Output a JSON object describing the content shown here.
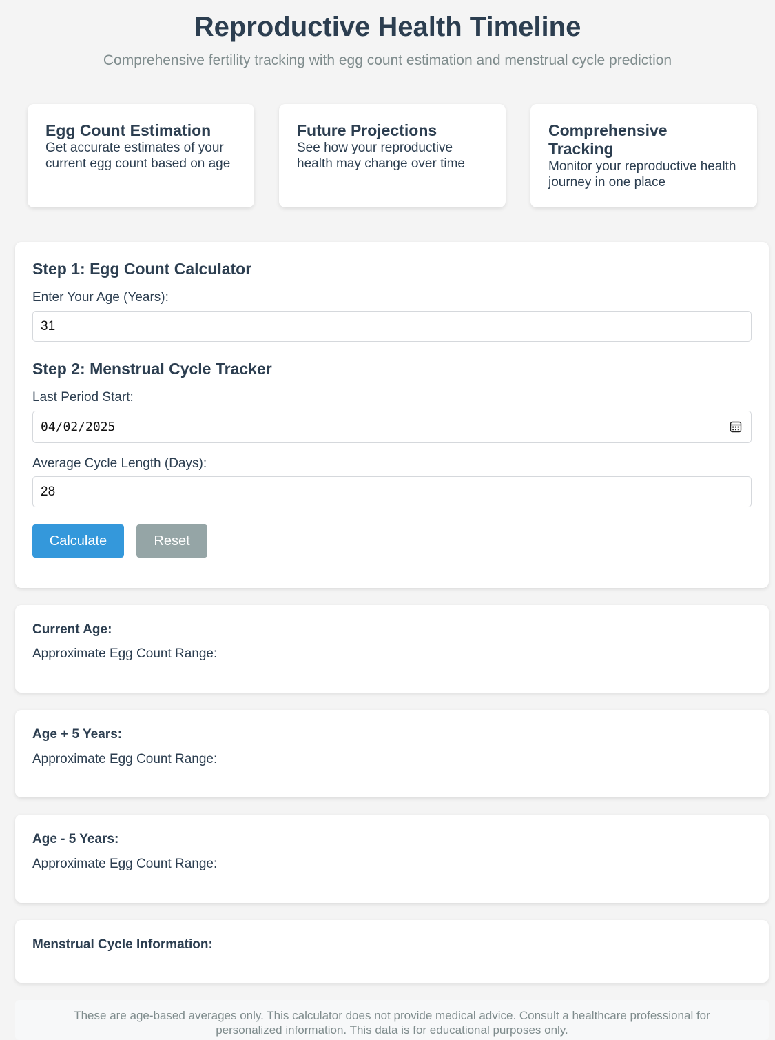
{
  "header": {
    "title": "Reproductive Health Timeline",
    "subtitle": "Comprehensive fertility tracking with egg count estimation and menstrual cycle prediction"
  },
  "features": [
    {
      "title": "Egg Count Estimation",
      "description": "Get accurate estimates of your current egg count based on age"
    },
    {
      "title": "Future Projections",
      "description": "See how your reproductive health may change over time"
    },
    {
      "title": "Comprehensive Tracking",
      "description": "Monitor your reproductive health journey in one place"
    }
  ],
  "form": {
    "step1_title": "Step 1: Egg Count Calculator",
    "age_label": "Enter Your Age (Years):",
    "age_value": "31",
    "step2_title": "Step 2: Menstrual Cycle Tracker",
    "period_label": "Last Period Start:",
    "period_value": "04/02/2025",
    "cycle_label": "Average Cycle Length (Days):",
    "cycle_value": "28",
    "calculate_label": "Calculate",
    "reset_label": "Reset"
  },
  "results": {
    "current": {
      "title": "Current Age:",
      "range_label": "Approximate Egg Count Range:"
    },
    "plus5": {
      "title": "Age + 5 Years:",
      "range_label": "Approximate Egg Count Range:"
    },
    "minus5": {
      "title": "Age - 5 Years:",
      "range_label": "Approximate Egg Count Range:"
    },
    "cycle": {
      "title": "Menstrual Cycle Information:"
    }
  },
  "disclaimer": "These are age-based averages only. This calculator does not provide medical advice. Consult a healthcare professional for personalized information. This data is for educational purposes only.",
  "colors": {
    "primary": "#3498db",
    "secondary": "#95a5a6",
    "heading": "#2c3e50",
    "muted": "#7f8c8d",
    "background": "#f4f4f4"
  },
  "icons": {
    "date_picker": "calendar-icon"
  }
}
